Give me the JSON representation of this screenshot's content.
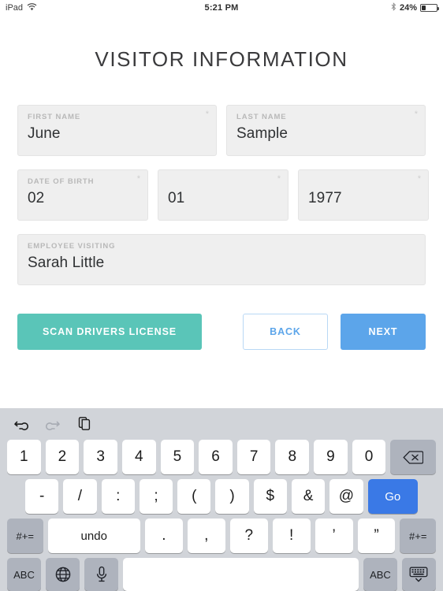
{
  "status_bar": {
    "device": "iPad",
    "wifi_icon": "wifi-icon",
    "time": "5:21 PM",
    "bluetooth_icon": "bluetooth-icon",
    "battery_percent": "24%"
  },
  "page": {
    "title": "VISITOR INFORMATION"
  },
  "form": {
    "required_marker": "*",
    "fields": [
      {
        "label": "FIRST NAME",
        "value": "June",
        "required": true
      },
      {
        "label": "LAST NAME",
        "value": "Sample",
        "required": true
      },
      {
        "label": "DATE OF BIRTH",
        "value": "02",
        "required": true
      },
      {
        "label": "",
        "value": "01",
        "required": true
      },
      {
        "label": "",
        "value": "1977",
        "required": true
      },
      {
        "label": "EMPLOYEE VISITING",
        "value": "Sarah Little",
        "required": false
      }
    ]
  },
  "buttons": {
    "scan": "SCAN DRIVERS LICENSE",
    "back": "BACK",
    "next": "NEXT"
  },
  "colors": {
    "scan_button": "#5ac5b8",
    "next_button": "#5ca5ea",
    "back_button_text": "#5ca5ea",
    "field_background": "#efefef",
    "label_text": "#b8b8b8",
    "value_text": "#2f3133",
    "keyboard_background": "#d1d4d9",
    "go_key": "#3a79e6"
  },
  "keyboard": {
    "toolbar": [
      {
        "name": "undo-icon",
        "enabled": true
      },
      {
        "name": "redo-icon",
        "enabled": false
      },
      {
        "name": "paste-icon",
        "enabled": true
      }
    ],
    "row_numbers": [
      "1",
      "2",
      "3",
      "4",
      "5",
      "6",
      "7",
      "8",
      "9",
      "0"
    ],
    "backspace": "⌫",
    "row_symbols": [
      "-",
      "/",
      ":",
      ";",
      "(",
      ")",
      "$",
      "&",
      "@"
    ],
    "go_key": "Go",
    "row_punctuation": {
      "left_modifier": "#+=",
      "undo": "undo",
      "keys": [
        ".",
        ",",
        "?",
        "!",
        "’",
        "”"
      ],
      "right_modifier": "#+="
    },
    "row_bottom": {
      "abc_left": "ABC",
      "globe_icon": "globe-icon",
      "mic_icon": "microphone-icon",
      "space": "",
      "abc_right": "ABC",
      "hide_keyboard_icon": "hide-keyboard-icon"
    }
  }
}
